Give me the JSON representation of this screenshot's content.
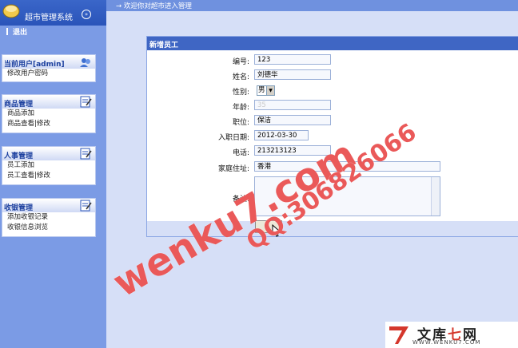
{
  "sidebar": {
    "title": "超市管理系统",
    "collapse_icon": "double-chevron-down-icon",
    "logout": "退出",
    "panels": [
      {
        "title": "当前用户[admin]",
        "icon": "users-icon",
        "items": [
          "修改用户密码"
        ]
      },
      {
        "title": "商品管理",
        "icon": "edit-note-icon",
        "items": [
          "商品添加",
          "商品查看|修改"
        ]
      },
      {
        "title": "人事管理",
        "icon": "edit-note-icon",
        "items": [
          "员工添加",
          "员工查看|修改"
        ]
      },
      {
        "title": "收银管理",
        "icon": "edit-note-icon",
        "items": [
          "添加收银记录",
          "收银信息浏览"
        ]
      }
    ]
  },
  "topbar": {
    "text": "→ 欢迎你对超市进入管理"
  },
  "form": {
    "title": "新增员工",
    "fields": {
      "id": {
        "label": "编号:",
        "value": "123"
      },
      "name": {
        "label": "姓名:",
        "value": "刘德华"
      },
      "gender": {
        "label": "性别:",
        "value": "男"
      },
      "age": {
        "label": "年龄:",
        "value": "35"
      },
      "position": {
        "label": "职位:",
        "value": "保洁"
      },
      "hire_date": {
        "label": "入职日期:",
        "value": "2012-03-30"
      },
      "phone": {
        "label": "电话:",
        "value": "213213123"
      },
      "address": {
        "label": "家庭住址:",
        "value": "香港"
      },
      "remark": {
        "label": "备注:",
        "value": ""
      }
    },
    "submit_label": ""
  },
  "watermark": {
    "line1": "wenku7.com",
    "line2": "QQ:306826066"
  },
  "footer": {
    "brand": "文库",
    "brand_accent": "七",
    "brand_tail": "网",
    "url": "WWW.WENKU7.COM"
  },
  "colors": {
    "sidebar_bg": "#7b9be5",
    "header_bg": "#3a66c9",
    "form_head": "#3f66c4",
    "content_bg": "#d6dff7",
    "watermark": "#e63c3c"
  }
}
